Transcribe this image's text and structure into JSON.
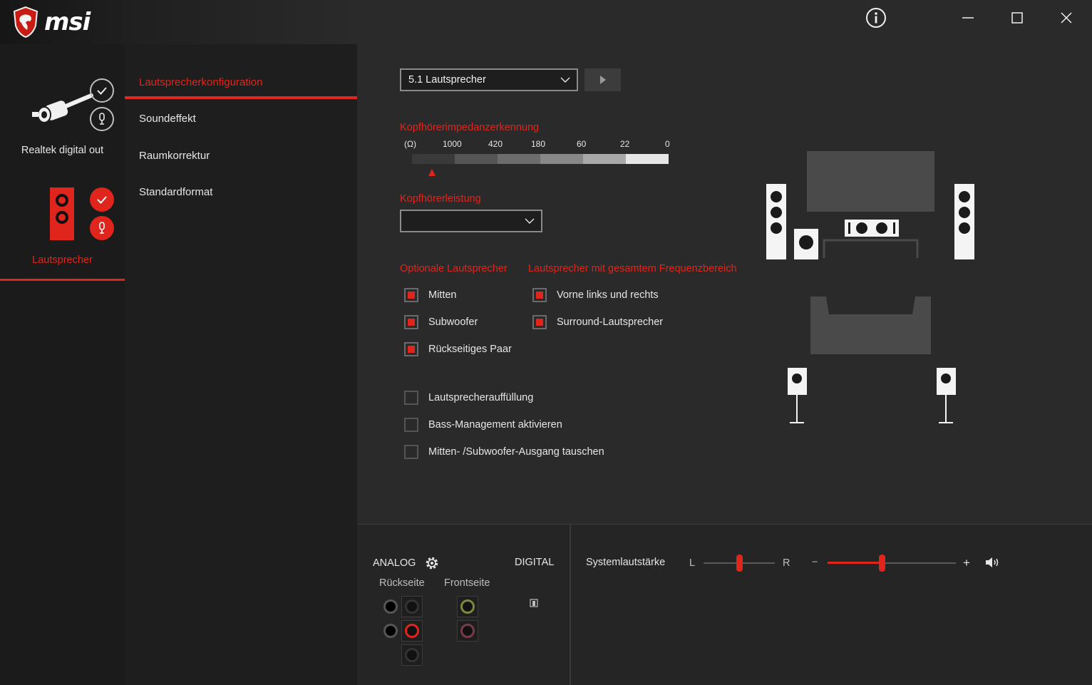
{
  "brand": {
    "name": "msi"
  },
  "devices": [
    {
      "label": "Realtek digital out",
      "active": false
    },
    {
      "label": "Lautsprecher",
      "active": true
    }
  ],
  "nav": {
    "items": [
      {
        "label": "Lautsprecherkonfiguration",
        "active": true
      },
      {
        "label": "Soundeffekt",
        "active": false
      },
      {
        "label": "Raumkorrektur",
        "active": false
      },
      {
        "label": "Standardformat",
        "active": false
      }
    ]
  },
  "window_controls": {
    "info": "info-icon",
    "minimize": "minimize-icon",
    "maximize": "maximize-icon",
    "close": "close-icon"
  },
  "config": {
    "speaker_select": "5.1 Lautsprecher",
    "impedance": {
      "title": "Kopfhörerimpedanzerkennung",
      "unit": "(Ω)",
      "scale": [
        "1000",
        "420",
        "180",
        "60",
        "22",
        "0"
      ]
    },
    "headphone_power": {
      "title": "Kopfhörerleistung",
      "value": ""
    },
    "optional": {
      "title": "Optionale Lautsprecher",
      "items": [
        {
          "label": "Mitten",
          "checked": true
        },
        {
          "label": "Subwoofer",
          "checked": true
        },
        {
          "label": "Rückseitiges Paar",
          "checked": true
        }
      ]
    },
    "fullrange": {
      "title": "Lautsprecher mit gesamtem Frequenzbereich",
      "items": [
        {
          "label": "Vorne links und rechts",
          "checked": true
        },
        {
          "label": "Surround-Lautsprecher",
          "checked": true
        }
      ]
    },
    "extras": [
      {
        "label": "Lautsprecherauffüllung",
        "checked": false
      },
      {
        "label": "Bass-Management aktivieren",
        "checked": false
      },
      {
        "label": "Mitten- /Subwoofer-Ausgang tauschen",
        "checked": false
      }
    ]
  },
  "bottom": {
    "analog": "ANALOG",
    "digital": "DIGITAL",
    "rear": "Rückseite",
    "front": "Frontseite",
    "system_volume": "Systemlautstärke",
    "balance_left": "L",
    "balance_right": "R",
    "vol_minus": "−",
    "vol_plus": "+",
    "balance_value": 0.5,
    "volume_value": 0.42
  },
  "colors": {
    "accent": "#e0251c",
    "background": "#2a2a2a",
    "panel": "#1e1e1e"
  }
}
